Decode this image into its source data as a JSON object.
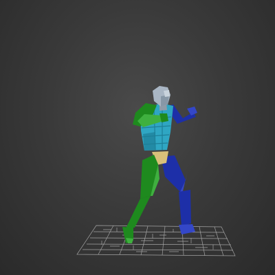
{
  "viewport": {
    "background": "#3a3a3a",
    "grid_color": "#b8b8b8"
  },
  "character": {
    "head_color": "#a9b6c4",
    "torso_color": "#2fa6c3",
    "torso_dark_color": "#1d7f98",
    "pelvis_color": "#d9c07a",
    "left_limb_color": "#1e8a1e",
    "left_limb_light_color": "#3fb03f",
    "right_limb_color": "#1d2fa8",
    "right_limb_light_color": "#3447c8"
  }
}
